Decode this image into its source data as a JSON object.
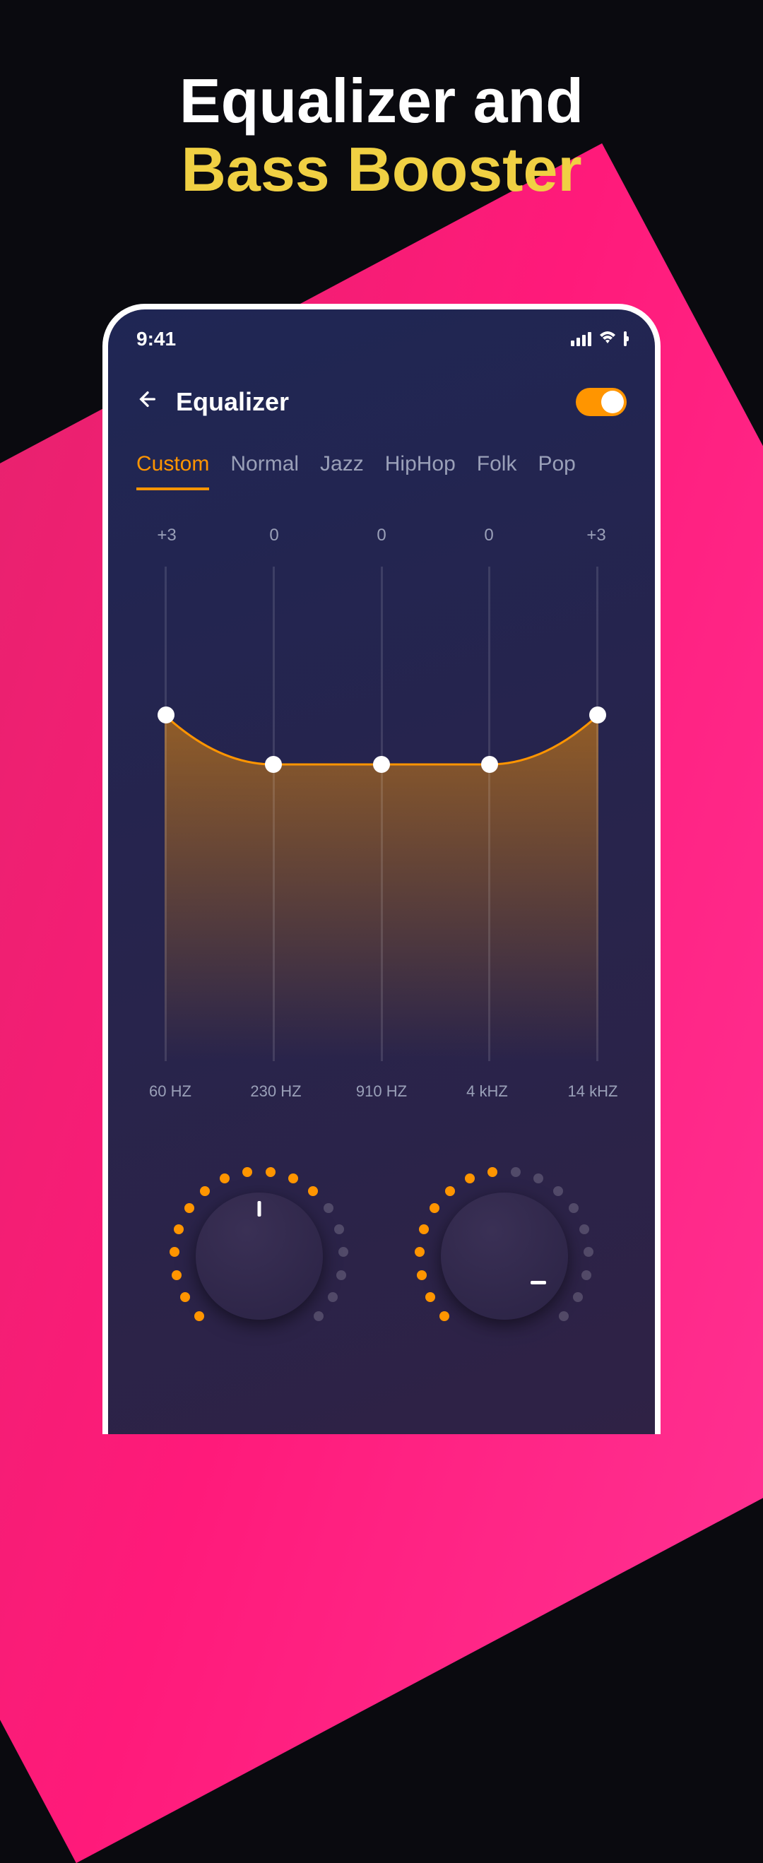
{
  "marketing": {
    "line1": "Equalizer and",
    "line2": "Bass Booster"
  },
  "status": {
    "time": "9:41"
  },
  "header": {
    "title": "Equalizer",
    "toggle_on": true
  },
  "tabs": [
    {
      "label": "Custom",
      "active": true
    },
    {
      "label": "Normal",
      "active": false
    },
    {
      "label": "Jazz",
      "active": false
    },
    {
      "label": "HipHop",
      "active": false
    },
    {
      "label": "Folk",
      "active": false
    },
    {
      "label": "Pop",
      "active": false
    }
  ],
  "eq": {
    "bands": [
      {
        "value": "+3",
        "freq": "60 HZ",
        "position": 0.3
      },
      {
        "value": "0",
        "freq": "230 HZ",
        "position": 0.4
      },
      {
        "value": "0",
        "freq": "910 HZ",
        "position": 0.4
      },
      {
        "value": "0",
        "freq": "4 kHZ",
        "position": 0.4
      },
      {
        "value": "+3",
        "freq": "14 kHZ",
        "position": 0.3
      }
    ]
  },
  "knobs": {
    "left": {
      "active_dots": 12,
      "total_dots": 18,
      "marker_angle": 0
    },
    "right": {
      "active_dots": 9,
      "total_dots": 18,
      "marker_angle": 120
    }
  },
  "colors": {
    "accent": "#ff9500",
    "text_muted": "#9aa0b8"
  }
}
